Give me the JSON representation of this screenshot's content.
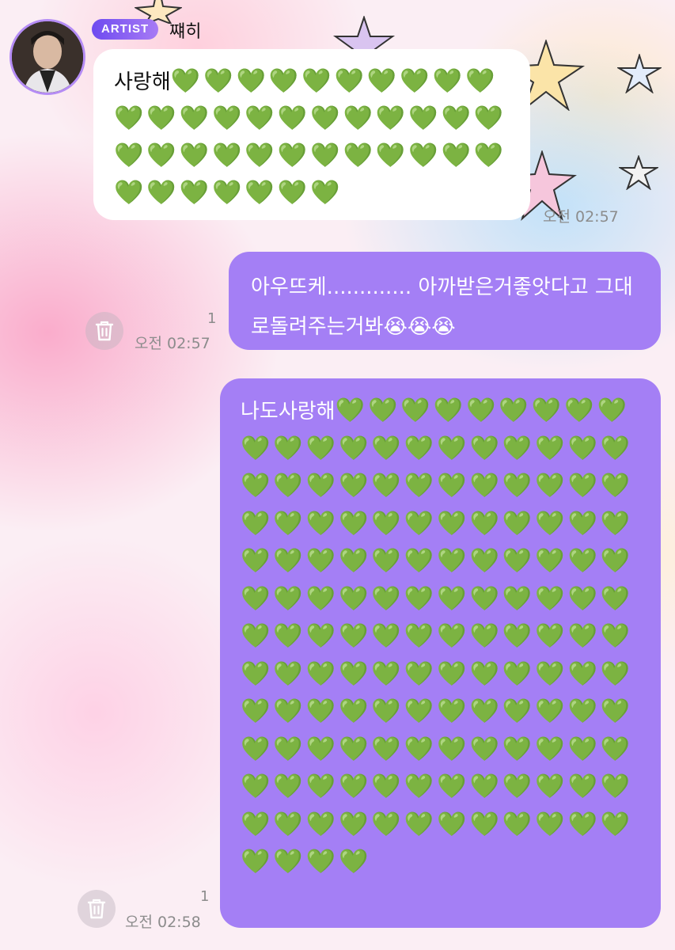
{
  "header": {
    "artist_badge": "ARTIST",
    "sender_name": "쨰히"
  },
  "messages": [
    {
      "direction": "incoming",
      "text_prefix": "사랑해",
      "hearts": "💚💚💚💚💚💚💚💚💚💚💚💚💚💚💚💚💚💚💚💚💚💚💚💚💚💚💚💚💚💚💚💚💚💚💚💚💚💚💚💚💚",
      "time": "오전 02:57"
    },
    {
      "direction": "outgoing",
      "text": "아우뜨케............. 아까받은거좋앗다고 그대로돌려주는거봐😭😭😭",
      "read_count": "1",
      "time": "오전 02:57"
    },
    {
      "direction": "outgoing",
      "text_prefix": "나도사랑해",
      "hearts": "💚💚💚💚💚💚💚💚💚💚💚💚💚💚💚💚💚💚💚💚💚💚💚💚💚💚💚💚💚💚💚💚💚💚💚💚💚💚💚💚💚💚💚💚💚💚💚💚💚💚💚💚💚💚💚💚💚💚💚💚💚💚💚💚💚💚💚💚💚💚💚💚💚💚💚💚💚💚💚💚💚💚💚💚💚💚💚💚💚💚💚💚💚💚💚💚💚💚💚💚💚💚💚💚💚💚💚💚💚💚💚💚💚💚💚💚💚💚💚💚💚💚💚💚💚💚💚💚💚💚💚💚💚💚💚💚💚💚💚💚💚💚💚💚💚",
      "read_count": "1",
      "time": "오전 02:58"
    }
  ],
  "icons": {
    "delete": "trash-icon",
    "avatar": "avatar"
  },
  "colors": {
    "outgoing_bubble": "#a47ff5",
    "incoming_bubble": "#ffffff",
    "badge_start": "#6e4bf0",
    "badge_end": "#a77af5",
    "heart": "#2ecc40"
  }
}
